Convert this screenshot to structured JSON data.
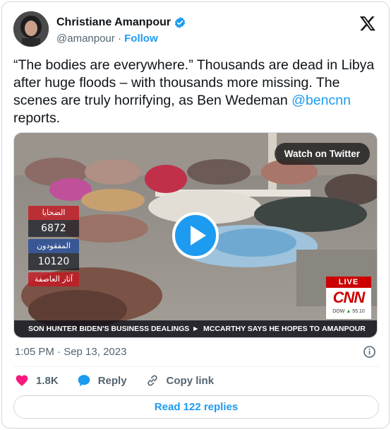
{
  "author": {
    "name": "Christiane Amanpour",
    "handle": "@amanpour",
    "separator": "·",
    "follow_label": "Follow"
  },
  "tweet": {
    "text_parts": [
      "“The bodies are everywhere.” Thousands are dead in Libya after huge floods – with thousands more missing. The scenes are truly horrifying, as Ben Wedeman ",
      "@bencnn",
      " reports."
    ]
  },
  "media": {
    "watch_label": "Watch on Twitter",
    "overlay": {
      "victims_label": "الضحايا",
      "victims_count": "6872",
      "missing_label": "المفقودون",
      "missing_count": "10120",
      "storm_label": "آثار العاصفة"
    },
    "ticker": {
      "left": "SON HUNTER BIDEN'S BUSINESS DEALINGS",
      "arrow": "►",
      "middle": "MCCARTHY SAYS HE HOPES TO",
      "right": "AMANPOUR"
    },
    "cnn": {
      "live": "LIVE",
      "logo": "CNN",
      "dow_label": "DOW",
      "dow_arrow": "▲",
      "dow_value": "55.10"
    }
  },
  "timestamp": "1:05 PM · Sep 13, 2023",
  "actions": {
    "likes": "1.8K",
    "reply": "Reply",
    "copy_link": "Copy link"
  },
  "read_replies": "Read 122 replies",
  "colors": {
    "accent": "#1d9bf0",
    "like": "#f91880",
    "text": "#0f1419",
    "muted": "#536471",
    "border": "#cfd9de"
  },
  "icons": [
    "verified-badge-icon",
    "x-logo-icon",
    "play-icon",
    "info-icon",
    "heart-icon",
    "reply-bubble-icon",
    "link-icon"
  ]
}
